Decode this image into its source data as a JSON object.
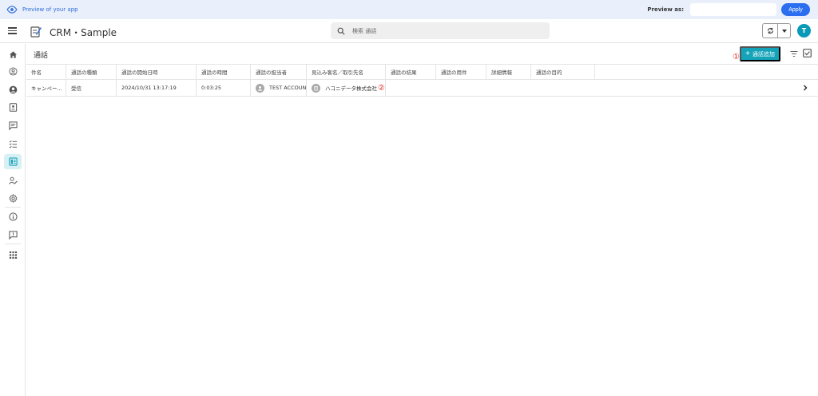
{
  "preview_bar": {
    "label": "Preview of your app",
    "preview_as_label": "Preview as:",
    "preview_as_value": "",
    "apply_label": "Apply"
  },
  "header": {
    "app_title": "CRM・Sample",
    "search_placeholder": "検索 通話",
    "avatar_initial": "T"
  },
  "sidebar": {
    "items": [
      {
        "icon": "home-icon"
      },
      {
        "icon": "account-circle-icon"
      },
      {
        "icon": "person-circle-icon"
      },
      {
        "icon": "contact-card-icon"
      },
      {
        "icon": "chat-icon"
      },
      {
        "icon": "checklist-icon"
      },
      {
        "icon": "calls-icon",
        "active": true
      },
      {
        "icon": "user-edit-icon"
      },
      {
        "icon": "settings-icon"
      },
      {
        "icon": "info-icon"
      },
      {
        "icon": "feedback-icon"
      },
      {
        "icon": "apps-grid-icon"
      }
    ]
  },
  "content": {
    "title": "通話",
    "add_button_label": "通話追加",
    "callout_1": "①",
    "callout_2": "②"
  },
  "table": {
    "columns": [
      "件名",
      "通話の種類",
      "通話の開始日時",
      "通話の時間",
      "通話の担当者",
      "見込み客名／取引先名",
      "通話の結果",
      "通話の用件",
      "詳細情報",
      "通話の目的"
    ],
    "rows": [
      {
        "subject": "キャンペー...",
        "call_type": "受信",
        "start_datetime": "2024/10/31 13:17:19",
        "duration": "0:03:25",
        "owner": "TEST ACCOUN",
        "lead_account": "ハコニデータ株式会社",
        "result": "",
        "purpose_item": "",
        "details": "",
        "objective": ""
      }
    ]
  },
  "colors": {
    "accent": "#14a3b8",
    "preview_bg": "#e9effb",
    "apply": "#2b6ff0",
    "callout": "#e02020"
  }
}
